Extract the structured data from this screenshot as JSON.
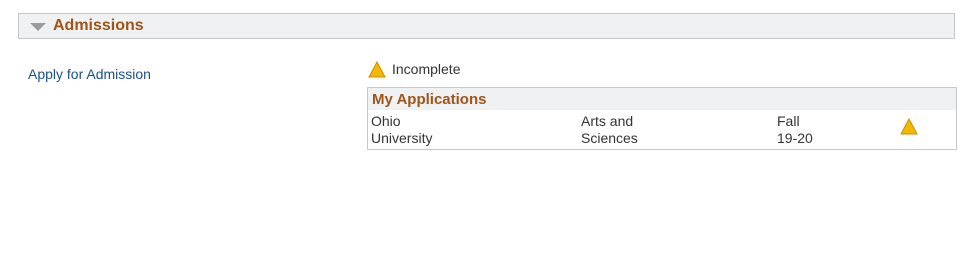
{
  "section": {
    "title": "Admissions",
    "toggle_icon": "triangle-down-icon"
  },
  "left": {
    "apply_link": "Apply for Admission"
  },
  "status": {
    "icon": "warning-icon",
    "text": "Incomplete",
    "icon_color": "#f5b800"
  },
  "applications": {
    "title": "My Applications",
    "rows": [
      {
        "institution": "Ohio\nUniversity",
        "program": "Arts and\nSciences",
        "term": "Fall\n19-20",
        "status_icon": "warning-icon"
      }
    ]
  },
  "colors": {
    "header_text": "#a05417",
    "link": "#19508f",
    "panel_bg": "#f0f1f2",
    "border": "#c6c9cc"
  }
}
